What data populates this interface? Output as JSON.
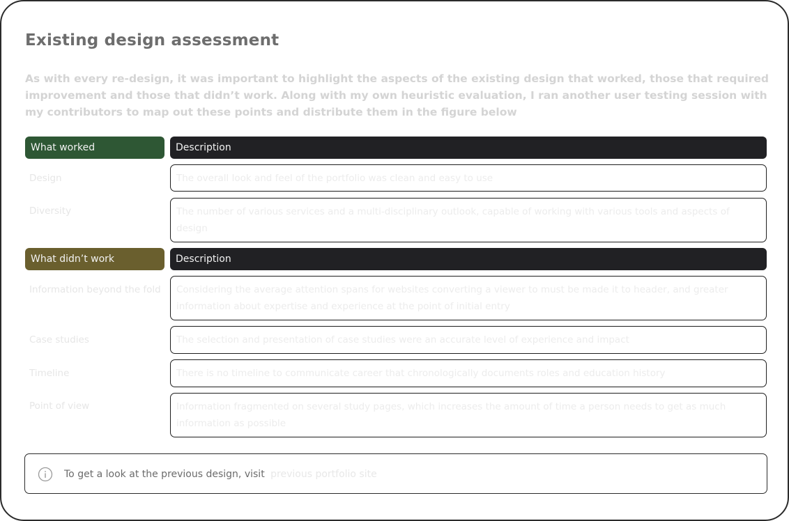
{
  "heading": "Existing design assessment",
  "intro": "As with every re-design, it was important to highlight the aspects of the existing design that worked, those that required improvement and those that didn’t work. Along with my own heuristic evaluation, I ran another user testing session with my contributors to map out these points and distribute them in the figure below",
  "worked": {
    "header_label": "What worked",
    "header_desc": "Description",
    "rows": [
      {
        "label": "Design",
        "text": "The overall look and feel of the portfolio was clean and easy to use"
      },
      {
        "label": "Diversity",
        "text": "The number of various services and a multi-disciplinary outlook, capable of working with various tools and aspects of design"
      }
    ]
  },
  "didnt": {
    "header_label": "What didn’t work",
    "header_desc": "Description",
    "rows": [
      {
        "label": "Information beyond the fold",
        "text": "Considering the average attention spans for websites converting a viewer to must be made it to header, and greater information about expertise and experience at the point of initial entry"
      },
      {
        "label": "Case studies",
        "text": "The selection and presentation of case studies were an accurate level of experience and impact"
      },
      {
        "label": "Timeline",
        "text": "There is no timeline to communicate career that chronologically documents roles and education history"
      },
      {
        "label": "Point of view",
        "text": "Information fragmented on several study pages, which increases the amount of time a person needs to get as much information as possible"
      }
    ]
  },
  "note": {
    "text": "To get a look at the previous design, visit",
    "link": "previous portfolio site"
  },
  "colors": {
    "worked_header": "#2e5734",
    "didnt_header": "#6a5f2e",
    "desc_header": "#212124"
  }
}
